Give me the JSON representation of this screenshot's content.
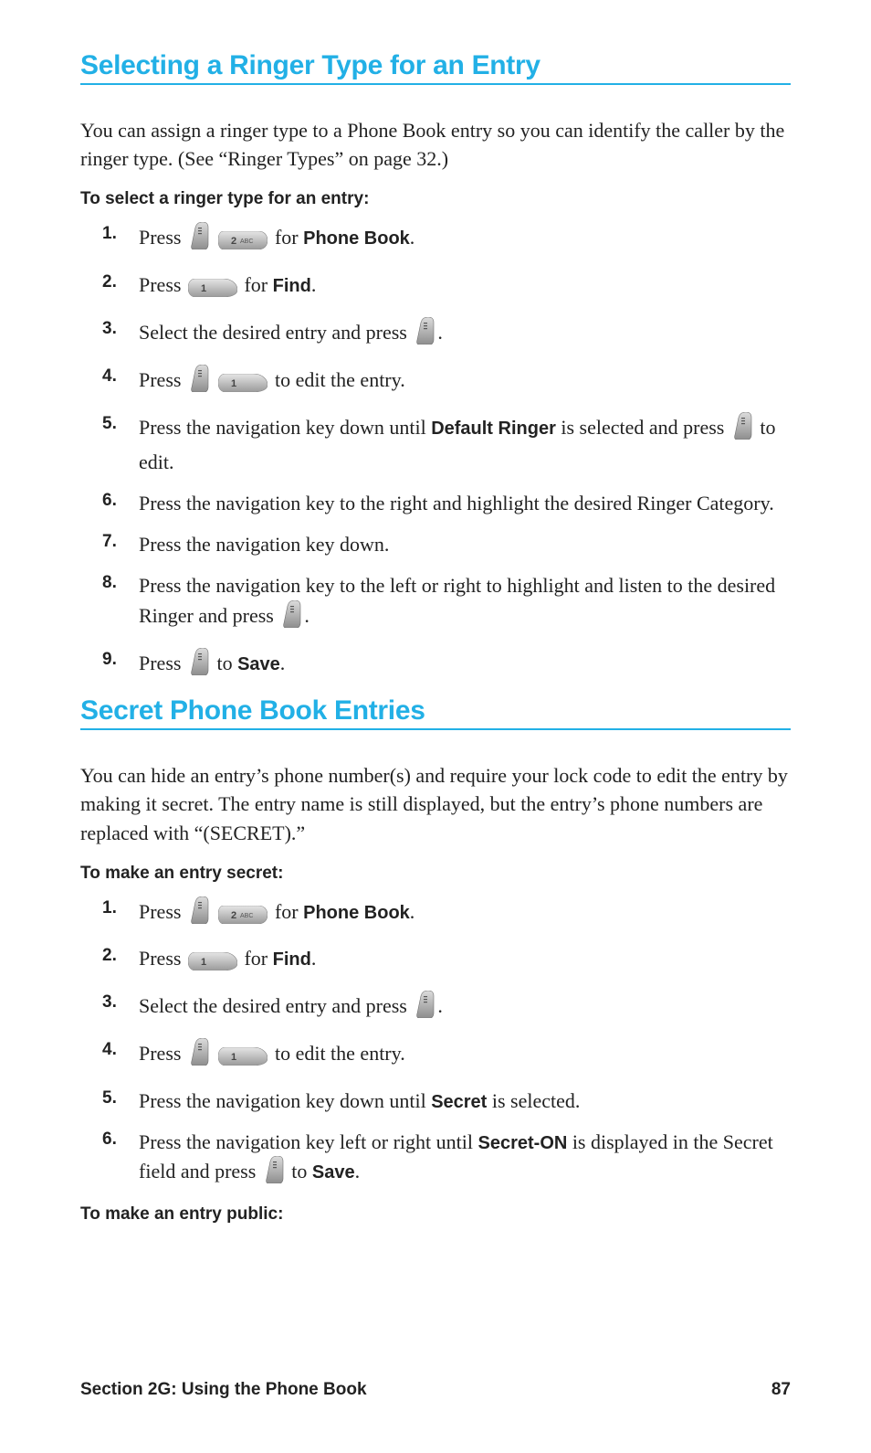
{
  "section1": {
    "title": "Selecting a Ringer Type for an Entry",
    "intro": "You can assign a ringer type to a Phone Book entry so you can identify the caller by the ringer type. (See “Ringer Types” on page 32.)",
    "subhead": "To select a ringer type for an entry:",
    "steps": {
      "s1a": "Press",
      "s1b": "for",
      "s1c": "Phone Book",
      "s1d": ".",
      "s2a": "Press",
      "s2b": "for",
      "s2c": "Find",
      "s2d": ".",
      "s3a": "Select the desired entry and press",
      "s3b": ".",
      "s4a": "Press",
      "s4b": "to edit the entry.",
      "s5a": "Press the navigation key down until",
      "s5b": "Default Ringer",
      "s5c": "is selected and press",
      "s5d": "to edit.",
      "s6": "Press the navigation key to the right and highlight the desired Ringer Category.",
      "s7": "Press the navigation key down.",
      "s8a": "Press the navigation key to the left or right to highlight and listen to the desired Ringer and press",
      "s8b": ".",
      "s9a": "Press",
      "s9b": "to",
      "s9c": "Save",
      "s9d": "."
    }
  },
  "section2": {
    "title": "Secret Phone Book Entries",
    "intro": "You can hide an entry’s phone number(s) and require your lock code to edit the entry by making it secret. The entry name is still displayed, but the entry’s phone numbers are replaced with “(SECRET).”",
    "subhead": "To make an entry secret:",
    "steps": {
      "s1a": "Press",
      "s1b": "for",
      "s1c": "Phone Book",
      "s1d": ".",
      "s2a": "Press",
      "s2b": "for",
      "s2c": "Find",
      "s2d": ".",
      "s3a": "Select the desired entry and press",
      "s3b": ".",
      "s4a": "Press",
      "s4b": "to edit the entry.",
      "s5a": "Press the navigation key down until",
      "s5b": "Secret",
      "s5c": "is selected.",
      "s6a": "Press the navigation key left or right until",
      "s6b": "Secret-ON",
      "s6c": "is displayed in the Secret field and press",
      "s6d": "to",
      "s6e": "Save",
      "s6f": "."
    },
    "subhead2": "To make an entry public:"
  },
  "footer": {
    "left": "Section 2G: Using the Phone Book",
    "right": "87"
  }
}
